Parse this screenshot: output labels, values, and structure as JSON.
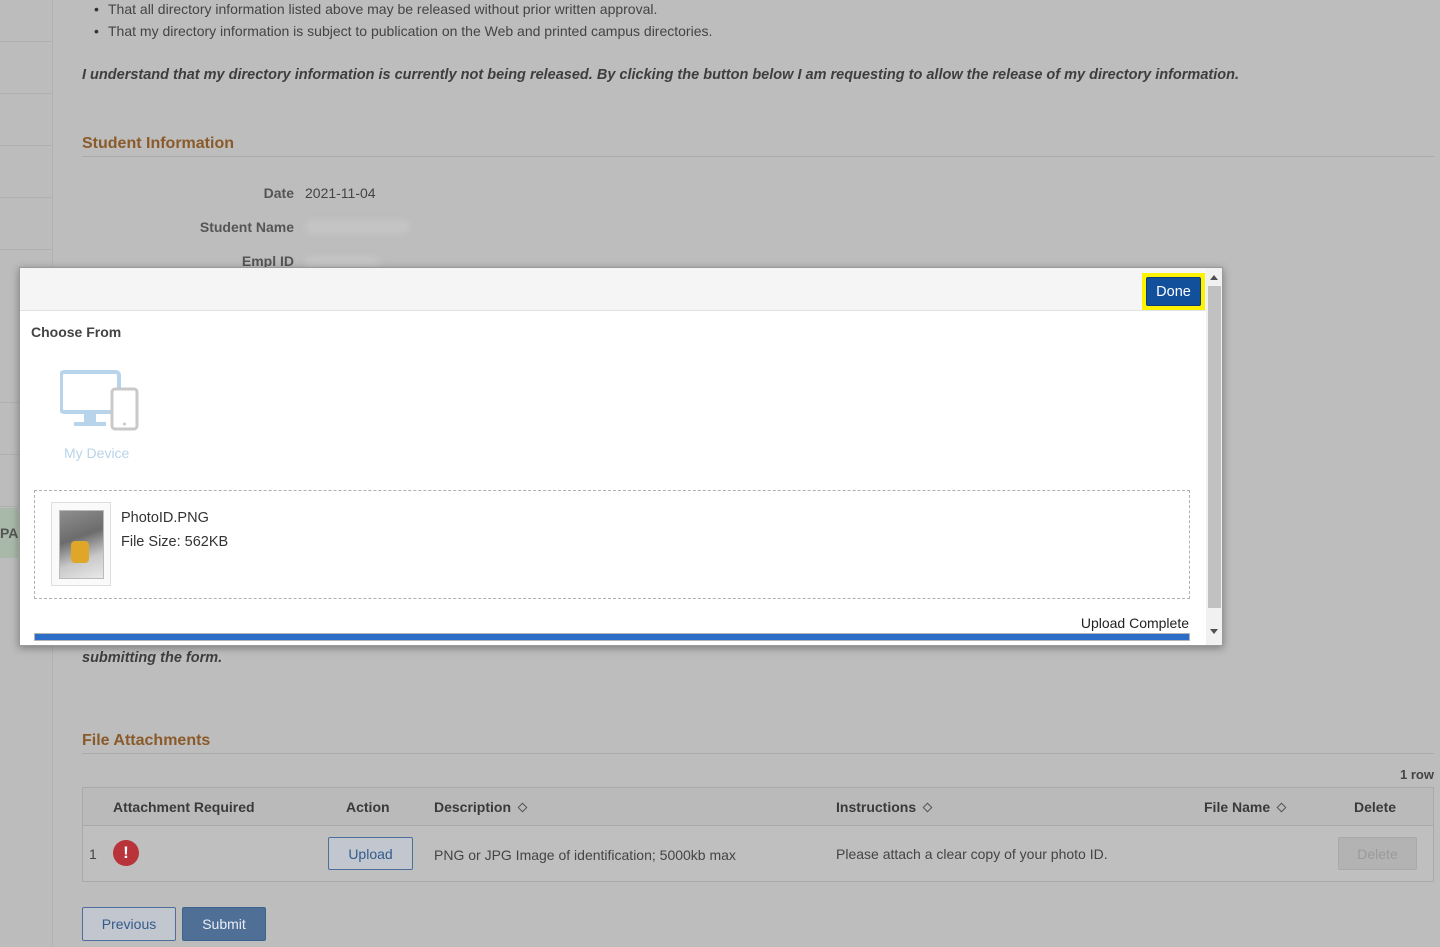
{
  "background": {
    "bullets": [
      "That all directory information listed above may be released without prior written approval.",
      "That my directory information is subject to publication on the Web and printed campus directories."
    ],
    "notice": "I understand that my directory information is currently not being released. By clicking the button below I am requesting to allow the release of my directory information.",
    "student_section": {
      "title": "Student Information",
      "fields": [
        {
          "label": "Date",
          "value": "2021-11-04"
        },
        {
          "label": "Student Name",
          "value": ""
        },
        {
          "label": "Empl ID",
          "value": ""
        }
      ]
    },
    "rail_tab_text": "PA",
    "submitting_text": "submitting the form.",
    "attachments": {
      "title": "File Attachments",
      "row_count": "1 row",
      "columns": [
        "Attachment Required",
        "Action",
        "Description",
        "Instructions",
        "File Name",
        "Delete"
      ],
      "rows": [
        {
          "index": "1",
          "required_icon": "exclamation-circle-icon",
          "action_label": "Upload",
          "description": "PNG or JPG Image of identification; 5000kb max",
          "instructions": "Please attach a clear copy of your photo ID.",
          "file_name": "",
          "delete_label": "Delete"
        }
      ]
    },
    "buttons": {
      "previous": "Previous",
      "submit": "Submit"
    }
  },
  "modal": {
    "done_label": "Done",
    "choose_from": "Choose From",
    "source": {
      "label": "My Device",
      "icon": "device-icon"
    },
    "file": {
      "name": "PhotoID.PNG",
      "size": "File Size: 562KB"
    },
    "upload_status": "Upload Complete",
    "progress": 1.0
  },
  "colors": {
    "accent": "#13509c",
    "section_title": "#8a5a2a",
    "highlight": "#fff200",
    "progress": "#2b6dc7",
    "error": "#b8333a"
  }
}
